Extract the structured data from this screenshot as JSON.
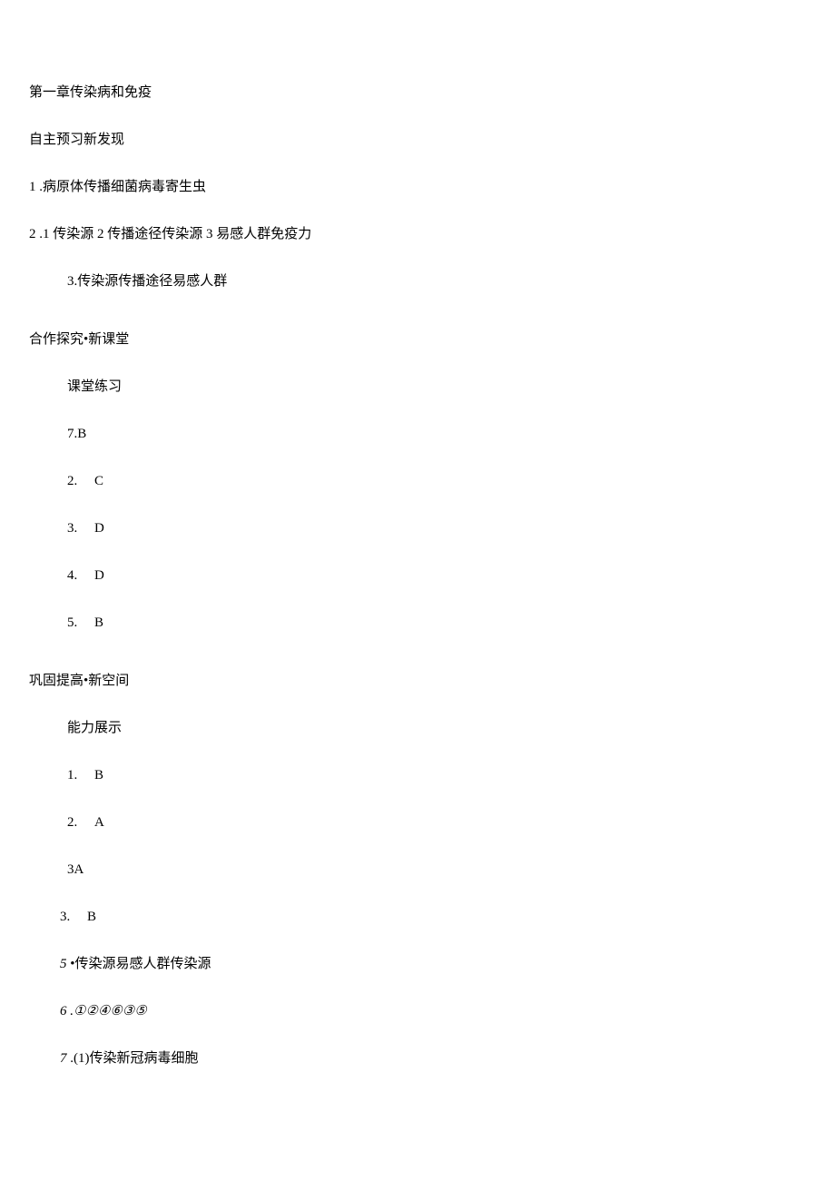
{
  "chapter_title": "第一章传染病和免疫",
  "section1": {
    "heading": "自主预习新发现",
    "item1": {
      "num": "1",
      "sep": " .",
      "text": "病原体传播细菌病毒寄生虫"
    },
    "item2": {
      "num": "2",
      "sep": "  .",
      "text": "1 传染源 2 传播途径传染源 3 易感人群免疫力"
    },
    "item3": {
      "num": "3.",
      "text": "传染源传播途径易感人群"
    }
  },
  "section2": {
    "heading": "合作探究•新课堂",
    "subheading": "课堂练习",
    "answers": {
      "a1": {
        "num": "7.",
        "val": "B"
      },
      "a2": {
        "num": "2.",
        "val": "C"
      },
      "a3": {
        "num": "3.",
        "val": "D"
      },
      "a4": {
        "num": "4.",
        "val": "D"
      },
      "a5": {
        "num": "5.",
        "val": "B"
      }
    }
  },
  "section3": {
    "heading": "巩固提高•新空间",
    "subheading": "能力展示",
    "answers": {
      "a1": {
        "num": "1.",
        "val": "B"
      },
      "a2": {
        "num": "2.",
        "val": "A"
      },
      "a3": {
        "num": "3",
        "val": "A"
      },
      "a4": {
        "num": "3.",
        "val": "B"
      },
      "a5": {
        "num": "5",
        "sep": "  •",
        "text": "传染源易感人群传染源"
      },
      "a6": {
        "num": "6",
        "sep": "  .",
        "text": "①②④⑥③⑤"
      },
      "a7": {
        "num": "7",
        "sep": "  .",
        "text": "(1)传染新冠病毒细胞"
      }
    }
  }
}
